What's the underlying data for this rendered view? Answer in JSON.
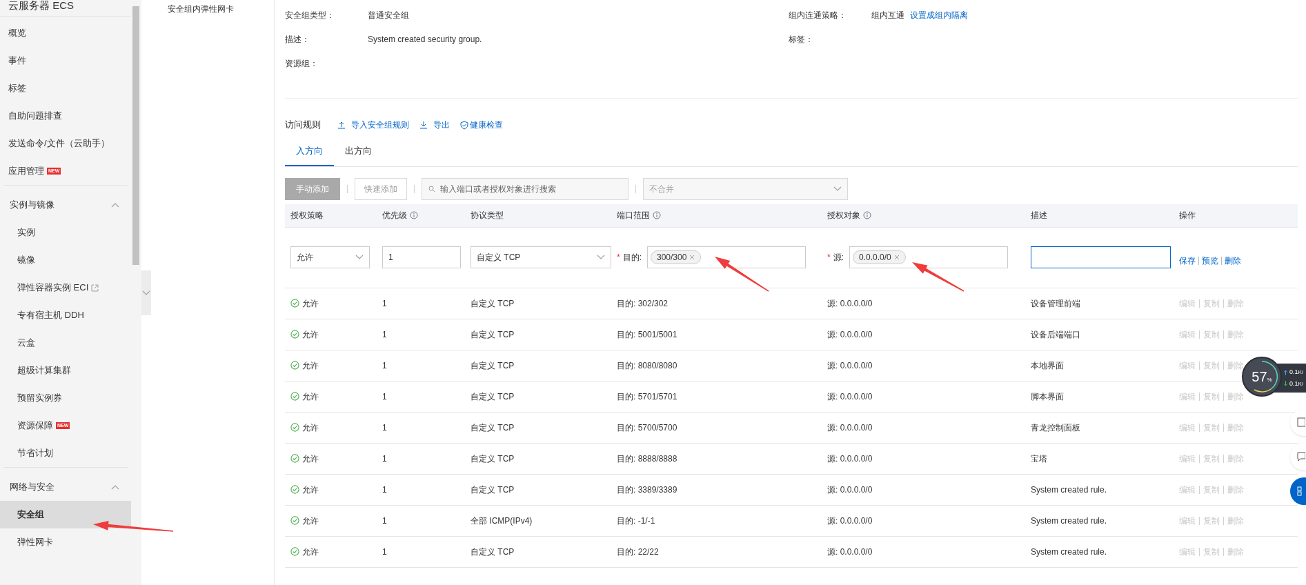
{
  "sidebar": {
    "title": "云服务器 ECS",
    "groups": [
      {
        "items": [
          {
            "label": "概览",
            "selected": false
          },
          {
            "label": "事件",
            "selected": false
          },
          {
            "label": "标签",
            "selected": false
          },
          {
            "label": "自助问题排查",
            "selected": false
          },
          {
            "label": "发送命令/文件（云助手）",
            "selected": false
          },
          {
            "label": "应用管理",
            "badge": "NEW",
            "selected": false
          }
        ]
      },
      {
        "title": "实例与镜像",
        "expanded": true,
        "items": [
          {
            "label": "实例",
            "selected": false
          },
          {
            "label": "镜像",
            "selected": false
          },
          {
            "label": "弹性容器实例 ECI",
            "external_link": true,
            "selected": false
          },
          {
            "label": "专有宿主机 DDH",
            "selected": false
          },
          {
            "label": "云盒",
            "selected": false
          },
          {
            "label": "超级计算集群",
            "selected": false
          },
          {
            "label": "预留实例券",
            "selected": false
          },
          {
            "label": "资源保障",
            "badge": "NEW",
            "selected": false
          },
          {
            "label": "节省计划",
            "selected": false
          }
        ]
      },
      {
        "title": "网络与安全",
        "expanded": true,
        "items": [
          {
            "label": "安全组",
            "selected": true
          },
          {
            "label": "弹性网卡",
            "selected": false
          }
        ]
      }
    ]
  },
  "subnav": {
    "items": [
      {
        "label": "安全组内弹性网卡",
        "selected": false
      }
    ]
  },
  "details": [
    {
      "label": "安全组类型：",
      "value": "普通安全组",
      "label2": "组内连通策略：",
      "value2": "组内互通",
      "link2": "设置成组内隔离"
    },
    {
      "label": "描述：",
      "value": "System created security group.",
      "label2": "标签："
    },
    {
      "label": "资源组："
    }
  ],
  "rules": {
    "title": "访问规则",
    "actions": [
      {
        "kind": "upload",
        "label": "导入安全组规则"
      },
      {
        "kind": "download",
        "label": "导出"
      },
      {
        "kind": "shield",
        "label": "健康检查"
      }
    ],
    "tabs": [
      {
        "label": "入方向",
        "selected": true
      },
      {
        "label": "出方向",
        "selected": false
      }
    ],
    "toolbar": {
      "add_manual": "手动添加",
      "add_quick": "快速添加",
      "search_placeholder": "输入端口或者授权对象进行搜索",
      "merge": "不合并"
    },
    "columns": [
      {
        "label": "授权策略",
        "info": false
      },
      {
        "label": "优先级",
        "info": true
      },
      {
        "label": "协议类型",
        "info": false
      },
      {
        "label": "端口范围",
        "info": true
      },
      {
        "label": "授权对象",
        "info": true
      },
      {
        "label": "描述",
        "info": false
      },
      {
        "label": "操作",
        "info": false
      }
    ],
    "edit_row": {
      "policy": "允许",
      "priority": "1",
      "protocol": "自定义 TCP",
      "port_label": "目的:",
      "port_tag": "300/300",
      "source_label": "源:",
      "source_tag": "0.0.0.0/0",
      "required_mark": "*",
      "actions": [
        "保存",
        "预览",
        "删除"
      ]
    },
    "rows": [
      {
        "policy": "允许",
        "priority": "1",
        "protocol": "自定义 TCP",
        "port": "目的: 302/302",
        "source": "源: 0.0.0.0/0",
        "description": "设备管理前端",
        "actions": [
          "编辑",
          "复制",
          "删除"
        ],
        "disabled": true
      },
      {
        "policy": "允许",
        "priority": "1",
        "protocol": "自定义 TCP",
        "port": "目的: 5001/5001",
        "source": "源: 0.0.0.0/0",
        "description": "设备后端端口",
        "actions": [
          "编辑",
          "复制",
          "删除"
        ],
        "disabled": true
      },
      {
        "policy": "允许",
        "priority": "1",
        "protocol": "自定义 TCP",
        "port": "目的: 8080/8080",
        "source": "源: 0.0.0.0/0",
        "description": "本地界面",
        "actions": [
          "编辑",
          "复制",
          "删除"
        ],
        "disabled": true
      },
      {
        "policy": "允许",
        "priority": "1",
        "protocol": "自定义 TCP",
        "port": "目的: 5701/5701",
        "source": "源: 0.0.0.0/0",
        "description": "脚本界面",
        "actions": [
          "编辑",
          "复制",
          "删除"
        ],
        "disabled": true
      },
      {
        "policy": "允许",
        "priority": "1",
        "protocol": "自定义 TCP",
        "port": "目的: 5700/5700",
        "source": "源: 0.0.0.0/0",
        "description": "青龙控制面板",
        "actions": [
          "编辑",
          "复制",
          "删除"
        ],
        "disabled": true
      },
      {
        "policy": "允许",
        "priority": "1",
        "protocol": "自定义 TCP",
        "port": "目的: 8888/8888",
        "source": "源: 0.0.0.0/0",
        "description": "宝塔",
        "actions": [
          "编辑",
          "复制",
          "删除"
        ],
        "disabled": true
      },
      {
        "policy": "允许",
        "priority": "1",
        "protocol": "自定义 TCP",
        "port": "目的: 3389/3389",
        "source": "源: 0.0.0.0/0",
        "description": "System created rule.",
        "actions": [
          "编辑",
          "复制",
          "删除"
        ],
        "disabled": true
      },
      {
        "policy": "允许",
        "priority": "1",
        "protocol": "全部 ICMP(IPv4)",
        "port": "目的: -1/-1",
        "source": "源: 0.0.0.0/0",
        "description": "System created rule.",
        "actions": [
          "编辑",
          "复制",
          "删除"
        ],
        "disabled": true
      },
      {
        "policy": "允许",
        "priority": "1",
        "protocol": "自定义 TCP",
        "port": "目的: 22/22",
        "source": "源: 0.0.0.0/0",
        "description": "System created rule.",
        "actions": [
          "编辑",
          "复制",
          "删除"
        ],
        "disabled": true
      }
    ]
  },
  "net_widget": {
    "percent": "57",
    "unit": "%",
    "up": "0.1",
    "up_unit": "K/",
    "down": "0.1",
    "down_unit": "K/"
  }
}
